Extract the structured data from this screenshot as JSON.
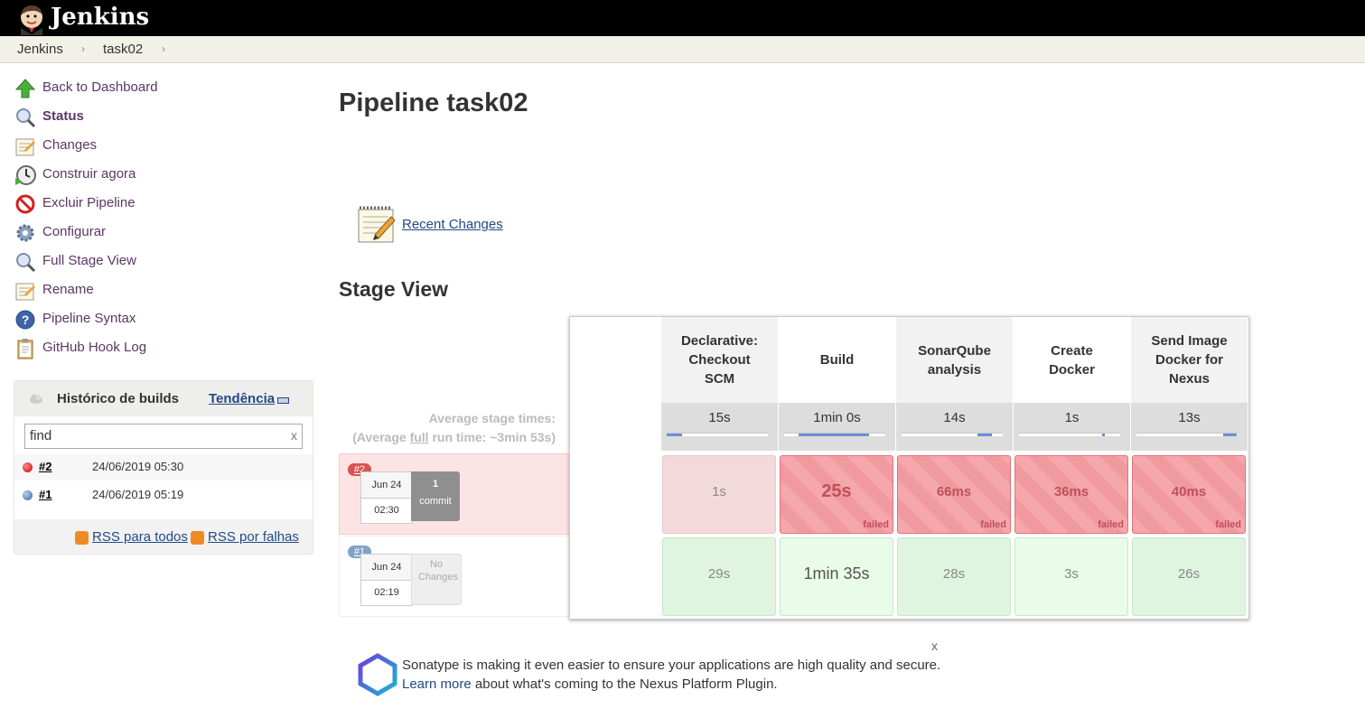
{
  "header": {
    "brand": "Jenkins"
  },
  "breadcrumb": [
    "Jenkins",
    "task02"
  ],
  "sidebar": {
    "items": [
      {
        "label": "Back to Dashboard",
        "icon": "up-arrow-icon"
      },
      {
        "label": "Status",
        "icon": "magnifier-icon"
      },
      {
        "label": "Changes",
        "icon": "notepad-icon"
      },
      {
        "label": "Construir agora",
        "icon": "clock-icon"
      },
      {
        "label": "Excluir Pipeline",
        "icon": "no-entry-icon"
      },
      {
        "label": "Configurar",
        "icon": "gear-icon"
      },
      {
        "label": "Full Stage View",
        "icon": "magnifier-icon"
      },
      {
        "label": "Rename",
        "icon": "notepad-icon"
      },
      {
        "label": "Pipeline Syntax",
        "icon": "help-icon"
      },
      {
        "label": "GitHub Hook Log",
        "icon": "clipboard-icon"
      }
    ]
  },
  "build_history": {
    "title": "Histórico de builds",
    "trend_label": "Tendência",
    "find_value": "find",
    "clear_label": "x",
    "builds": [
      {
        "number": "#2",
        "date": "24/06/2019 05:30",
        "status_color": "#cc0000"
      },
      {
        "number": "#1",
        "date": "24/06/2019 05:19",
        "status_color": "#3465a4"
      }
    ],
    "rss_all": "RSS para todos",
    "rss_failures": "RSS por falhas"
  },
  "main": {
    "title": "Pipeline task02",
    "recent_changes": "Recent Changes",
    "stage_view_title": "Stage View",
    "avg_stage_times": "Average stage times:",
    "avg_run_prefix": "(Average ",
    "avg_run_full": "full",
    "avg_run_suffix": " run time: ~3min 53s)"
  },
  "runs": [
    {
      "badge": "#2",
      "date": "Jun 24",
      "time": "02:30",
      "changes_count": "1",
      "changes_label": "commit",
      "badge_color": "#d9534f"
    },
    {
      "badge": "#1",
      "date": "Jun 24",
      "time": "02:19",
      "changes_count": "",
      "changes_label": "No Changes",
      "badge_color": "#7fa3c8"
    }
  ],
  "stages": [
    {
      "name": "Declarative: Checkout SCM",
      "avg": "15s",
      "avg_fraction": 0.15
    },
    {
      "name": "Build",
      "avg": "1min 0s",
      "avg_fraction": 0.7
    },
    {
      "name": "SonarQube analysis",
      "avg": "14s",
      "avg_fraction": 0.14
    },
    {
      "name": "Create Docker",
      "avg": "1s",
      "avg_fraction": 0.02
    },
    {
      "name": "Send Image Docker for Nexus",
      "avg": "13s",
      "avg_fraction": 0.13
    }
  ],
  "stage_cells": [
    [
      {
        "value": "1s",
        "status": "skipped",
        "status_label": ""
      },
      {
        "value": "25s",
        "status": "failed",
        "status_label": "failed"
      },
      {
        "value": "66ms",
        "status": "failed",
        "status_label": "failed"
      },
      {
        "value": "36ms",
        "status": "failed",
        "status_label": "failed"
      },
      {
        "value": "40ms",
        "status": "failed",
        "status_label": "failed"
      }
    ],
    [
      {
        "value": "29s",
        "status": "success",
        "status_label": ""
      },
      {
        "value": "1min 35s",
        "status": "success",
        "status_label": ""
      },
      {
        "value": "28s",
        "status": "success",
        "status_label": ""
      },
      {
        "value": "3s",
        "status": "success",
        "status_label": ""
      },
      {
        "value": "26s",
        "status": "success",
        "status_label": ""
      }
    ]
  ],
  "sonatype": {
    "close_label": "x",
    "line1": "Sonatype is making it even easier to ensure your applications are high quality and secure.",
    "learn_more": "Learn more",
    "line2_rest": " about what's coming to the Nexus Platform Plugin."
  }
}
